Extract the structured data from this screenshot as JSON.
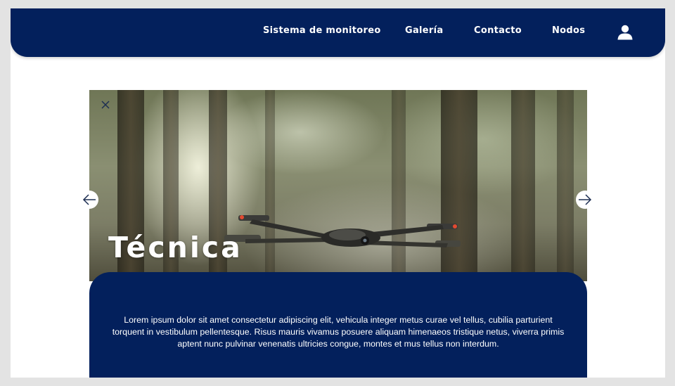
{
  "navbar": {
    "links": [
      "Sistema de monitoreo",
      "Galería",
      "Contacto",
      "Nodos"
    ],
    "user_icon": "user-icon"
  },
  "carousel": {
    "title": "Técnica",
    "description": "Lorem ipsum dolor sit amet consectetur adipiscing elit, vehicula integer metus curae vel tellus, cubilia parturient torquent in vestibulum pellentesque. Risus mauris vivamus posuere aliquam himenaeos tristique netus, viverra primis aptent nunc pulvinar venenatis ultricies congue, montes et mus tellus non interdum.",
    "close_icon": "close-icon",
    "prev_icon": "arrow-left-icon",
    "next_icon": "arrow-right-icon",
    "image": "drone-in-forest-photo"
  },
  "colors": {
    "primary": "#03205c",
    "background": "#ffffff",
    "frame_border": "#e3e3e3",
    "text_on_primary": "#ffffff"
  }
}
